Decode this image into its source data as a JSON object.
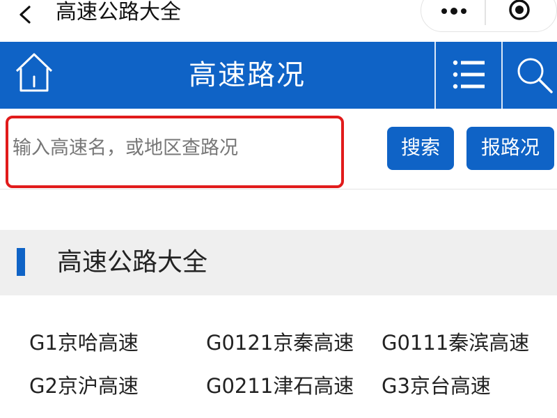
{
  "topbar": {
    "title": "高速公路大全",
    "back_icon": "chevron-left-icon",
    "more_icon": "more-dots-icon",
    "close_icon": "target-icon"
  },
  "header": {
    "title": "高速路况",
    "home_icon": "home-icon",
    "menu_icon": "list-menu-icon",
    "search_icon": "search-icon",
    "background_color": "#0f63c6"
  },
  "search": {
    "placeholder": "输入高速名，或地区查路况",
    "value": "",
    "search_button": "搜索",
    "report_button": "报路况",
    "highlight_color": "#e11b1b"
  },
  "section": {
    "title": "高速公路大全"
  },
  "highways": [
    "G1京哈高速",
    "G0121京秦高速",
    "G0111秦滨高速",
    "G2京沪高速",
    "G0211津石高速",
    "G3京台高速"
  ]
}
